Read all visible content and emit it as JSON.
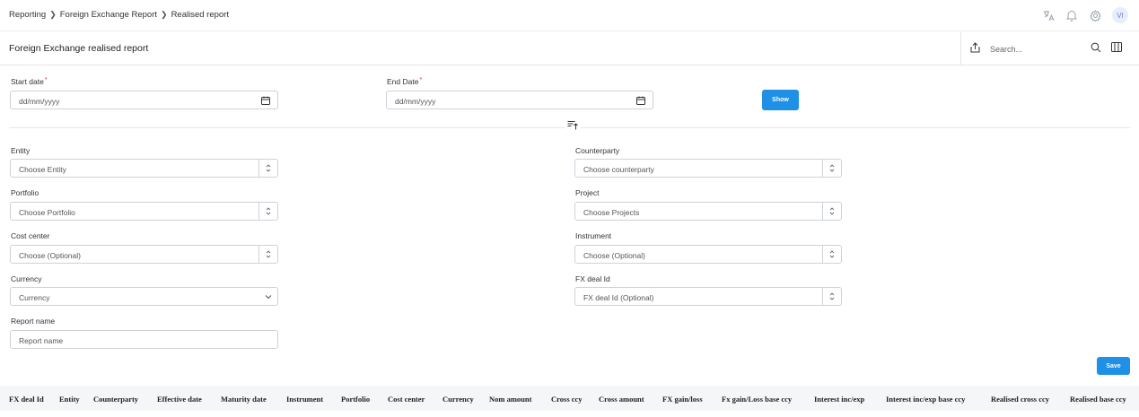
{
  "breadcrumb": [
    "Reporting",
    "Foreign Exchange Report",
    "Realised report"
  ],
  "topbar": {
    "avatar_initials": "VI"
  },
  "page": {
    "title": "Foreign Exchange realised report"
  },
  "search": {
    "placeholder": "Search..."
  },
  "dates": {
    "start_label": "Start date",
    "end_label": "End Date",
    "required_mark": "*",
    "start_placeholder": "dd/mm/yyyy",
    "end_placeholder": "dd/mm/yyyy",
    "show_label": "Show"
  },
  "filters": {
    "entity_label": "Entity",
    "entity_value": "Choose Entity",
    "counterparty_label": "Counterparty",
    "counterparty_value": "Choose counterparty",
    "portfolio_label": "Portfolio",
    "portfolio_value": "Choose Portfolio",
    "project_label": "Project",
    "project_value": "Choose Projects",
    "cost_center_label": "Cost center",
    "cost_center_value": "Choose (Optional)",
    "instrument_label": "Instrument",
    "instrument_value": "Choose (Optional)",
    "currency_label": "Currency",
    "currency_value": "Currency",
    "fx_deal_label": "FX deal Id",
    "fx_deal_value": "FX deal Id (Optional)",
    "report_name_label": "Report name",
    "report_name_placeholder": "Report name"
  },
  "save_label": "Save",
  "table": {
    "columns": [
      "FX deal Id",
      "Entity",
      "Counterparty",
      "Effective date",
      "Maturity date",
      "Instrument",
      "Portfolio",
      "Cost center",
      "Currency",
      "Nom amount",
      "Cross ccy",
      "Cross amount",
      "FX gain/loss",
      "Fx gain/Loss base ccy",
      "Interest inc/exp",
      "Interest inc/exp base ccy",
      "Realised cross ccy",
      "Realised base ccy"
    ]
  },
  "colors": {
    "accent": "#1e90e6",
    "border": "#cdd2d8",
    "header_bg": "#f5f6f7"
  }
}
